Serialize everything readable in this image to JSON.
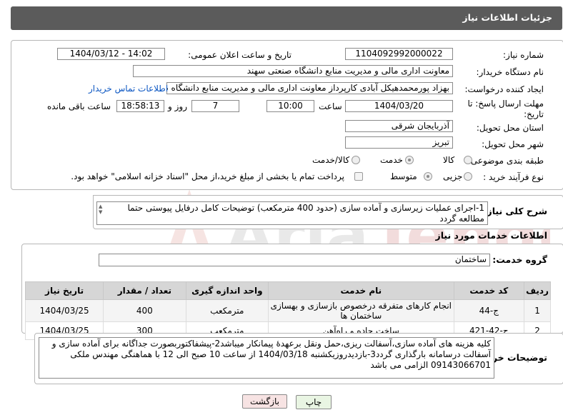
{
  "header": {
    "title": "جزئیات اطلاعات نیاز"
  },
  "form": {
    "need_number_label": "شماره نیاز:",
    "need_number": "1104092992000022",
    "announce_label": "تاریخ و ساعت اعلان عمومی:",
    "announce_value": "1404/03/12 - 14:02",
    "buyer_org_label": "نام دستگاه خریدار:",
    "buyer_org": "معاونت اداری  مالی و مدیریت منابع دانشگاه صنعتی سهند",
    "creator_label": "ایجاد کننده درخواست:",
    "creator": "بهزاد پورمحمدهیکل آبادی کارپرداز معاونت اداری  مالی و مدیریت منابع دانشگاه ص",
    "contact_link": "اطلاعات تماس خریدار",
    "deadline_label": "مهلت ارسال پاسخ: تا",
    "deadline_label2": "تاریخ:",
    "deadline_date": "1404/03/20",
    "time_label": "ساعت",
    "deadline_time": "10:00",
    "days_value": "7",
    "days_label": "روز و",
    "remaining_time": "18:58:13",
    "remaining_label": "ساعت باقی مانده",
    "province_label": "استان محل تحویل:",
    "province": "آذربایجان شرقی",
    "city_label": "شهر محل تحویل:",
    "city": "تبریز",
    "category_label": "طبقه بندی موضوعی:",
    "category_options": [
      "کالا",
      "خدمت",
      "کالا/خدمت"
    ],
    "category_selected": "خدمت",
    "process_label": "نوع فرآیند خرید :",
    "process_options": [
      "جزیی",
      "متوسط"
    ],
    "process_selected": "متوسط",
    "payment_note": "پرداخت تمام یا بخشی از مبلغ خرید،از محل \"اسناد خزانه اسلامی\" خواهد بود."
  },
  "summary": {
    "label": "شرح کلی نیاز:",
    "text": "1-اجرای عملیات زیرسازی و آماده سازی (حدود 400 مترمکعب) توضیحات کامل درفایل پیوستی حتما مطالعه گردد"
  },
  "services": {
    "section_title": "اطلاعات خدمات مورد نیاز",
    "group_label": "گروه خدمت:",
    "group_value": "ساختمان",
    "columns": [
      "ردیف",
      "کد خدمت",
      "نام خدمت",
      "واحد اندازه گیری",
      "تعداد / مقدار",
      "تاریخ نیاز"
    ],
    "rows": [
      [
        "1",
        "ج-44",
        "انجام کارهای متفرقه درخصوص بازسازی و بهسازی ساختمان ها",
        "مترمکعب",
        "400",
        "1404/03/25"
      ],
      [
        "2",
        "ج-42-421",
        "ساخت جاده و راه‌آهن",
        "مترمکعب",
        "300",
        "1404/03/25"
      ]
    ]
  },
  "buyer_notes": {
    "label": "توضیحات خریدار:",
    "text": "کلیه هزینه های آماده سازی،آسفالت ریزی،حمل ونقل برعهدهٔ پیمانکار میباشد2-پیشفاکتوربصورت جداگانه برای آماده سازی و آسفالت درسامانه بارگذاری گردد3-بازدیدروزیکشنبه 1404/03/18 از ساعت 10 صبح الی 12 با هماهنگی مهندس ملکی 09143066701 الزامی می باشد"
  },
  "buttons": {
    "print": "چاپ",
    "back": "بازگشت"
  },
  "colors": {
    "header_bg": "#5b5b5b",
    "link": "#0b56c2",
    "back_button": "#f7e3e3",
    "print_button": "#e9f5e3"
  }
}
